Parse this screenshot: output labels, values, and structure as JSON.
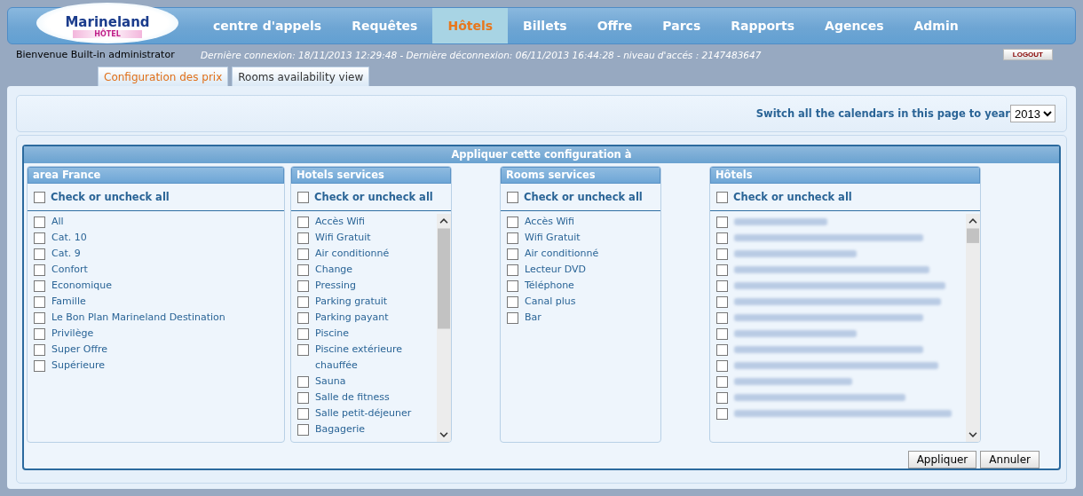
{
  "nav": {
    "logo": {
      "brand": "Marineland",
      "sub": "HÔTEL"
    },
    "items": [
      {
        "label": "centre d'appels",
        "selected": false
      },
      {
        "label": "Requêtes",
        "selected": false
      },
      {
        "label": "Hôtels",
        "selected": true
      },
      {
        "label": "Billets",
        "selected": false
      },
      {
        "label": "Offre",
        "selected": false
      },
      {
        "label": "Parcs",
        "selected": false
      },
      {
        "label": "Rapports",
        "selected": false
      },
      {
        "label": "Agences",
        "selected": false
      },
      {
        "label": "Admin",
        "selected": false
      }
    ]
  },
  "welcome": "Bienvenue Built-in administrator",
  "session": "Dernière connexion: 18/11/2013 12:29:48 - Dernière déconnexion: 06/11/2013 16:44:28 - niveau d'accés : 2147483647",
  "logout": "LOGOUT",
  "tabs": [
    {
      "label": "Configuration des prix",
      "selected": true
    },
    {
      "label": "Rooms availability view",
      "selected": false
    }
  ],
  "year_switch": {
    "label": "Switch all the calendars in this page to year",
    "value": "2013"
  },
  "dialog": {
    "title": "Appliquer cette configuration à",
    "panels": [
      {
        "kind": "plain",
        "title": "area France",
        "check_all": {
          "label": "Check or uncheck all",
          "checked": false
        },
        "items": [
          {
            "label": "All",
            "checked": false
          },
          {
            "label": "Cat. 10",
            "checked": false
          },
          {
            "label": "Cat. 9",
            "checked": false
          },
          {
            "label": "Confort",
            "checked": false
          },
          {
            "label": "Economique",
            "checked": false
          },
          {
            "label": "Famille",
            "checked": false
          },
          {
            "label": "Le Bon Plan Marineland Destination",
            "checked": false
          },
          {
            "label": "Privilège",
            "checked": false
          },
          {
            "label": "Super Offre",
            "checked": false
          },
          {
            "label": "Supérieure",
            "checked": false
          }
        ]
      },
      {
        "kind": "scroll",
        "title": "Hotels services",
        "check_all": {
          "label": "Check or uncheck all",
          "checked": false
        },
        "items": [
          {
            "label": "Accès Wifi",
            "checked": false
          },
          {
            "label": "Wifi Gratuit",
            "checked": false
          },
          {
            "label": "Air conditionné",
            "checked": false
          },
          {
            "label": "Change",
            "checked": false
          },
          {
            "label": "Pressing",
            "checked": false
          },
          {
            "label": "Parking gratuit",
            "checked": false
          },
          {
            "label": "Parking payant",
            "checked": false
          },
          {
            "label": "Piscine",
            "checked": false
          },
          {
            "label": "Piscine extérieure chauffée",
            "checked": false
          },
          {
            "label": "Sauna",
            "checked": false
          },
          {
            "label": "Salle de fitness",
            "checked": false
          },
          {
            "label": "Salle petit-déjeuner",
            "checked": false
          },
          {
            "label": "Bagagerie",
            "checked": false
          }
        ]
      },
      {
        "kind": "plain",
        "title": "Rooms services",
        "check_all": {
          "label": "Check or uncheck all",
          "checked": false
        },
        "items": [
          {
            "label": "Accès Wifi",
            "checked": false
          },
          {
            "label": "Wifi Gratuit",
            "checked": false
          },
          {
            "label": "Air conditionné",
            "checked": false
          },
          {
            "label": "Lecteur DVD",
            "checked": false
          },
          {
            "label": "Téléphone",
            "checked": false
          },
          {
            "label": "Canal plus",
            "checked": false
          },
          {
            "label": "Bar",
            "checked": false
          }
        ]
      },
      {
        "kind": "redacted",
        "title": "Hôtels",
        "check_all": {
          "label": "Check or uncheck all",
          "checked": false
        },
        "items": [
          {
            "checked": false
          },
          {
            "checked": false
          },
          {
            "checked": false
          },
          {
            "checked": false
          },
          {
            "checked": false
          },
          {
            "checked": false
          },
          {
            "checked": false
          },
          {
            "checked": false
          },
          {
            "checked": false
          },
          {
            "checked": false
          },
          {
            "checked": false
          },
          {
            "checked": false
          },
          {
            "checked": false
          }
        ]
      }
    ]
  },
  "buttons": [
    "Appliquer",
    "Annuler"
  ]
}
